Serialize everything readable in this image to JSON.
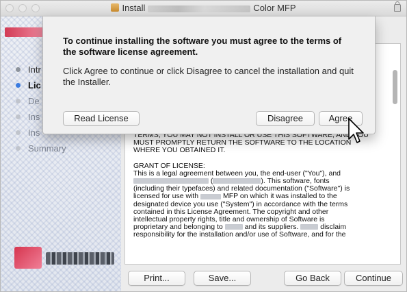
{
  "window": {
    "title_prefix": "Install",
    "title_suffix": "Color MFP"
  },
  "sidebar": {
    "steps": [
      {
        "label": "Intr",
        "state": "done"
      },
      {
        "label": "Lic",
        "state": "active"
      },
      {
        "label": "De",
        "state": "pending"
      },
      {
        "label": "Ins",
        "state": "pending"
      },
      {
        "label": "Ins",
        "state": "pending"
      },
      {
        "label": "Summary",
        "state": "pending"
      }
    ]
  },
  "license": {
    "paragraph1": "TERMS, YOU MAY NOT INSTALL OR USE THIS SOFTWARE, AND YOU MUST PROMPTLY RETURN THE SOFTWARE TO THE LOCATION WHERE YOU OBTAINED IT.",
    "heading2": "GRANT OF LICENSE:",
    "line2a": "This is a legal agreement between you, the end-user (\"You\"), and",
    "line2b": "). This software, fonts",
    "line2c": "(including their typefaces) and related documentation (\"Software\") is",
    "line2d_pre": "licensed for use with",
    "line2d_post": "MFP  on which it was installed to the",
    "line2e": "designated device you use (\"System\") in accordance with the terms",
    "line2f": "contained in this License Agreement.  The copyright and other",
    "line2g": "intellectual property rights, title and ownership of Software is",
    "line2h_pre": "proprietary and belonging to",
    "line2h_mid": "and its suppliers.",
    "line2h_post": "disclaim",
    "line2i": "responsibility for the installation and/or use of Software, and for the"
  },
  "buttons": {
    "print": "Print...",
    "save": "Save...",
    "go_back": "Go Back",
    "continue": "Continue"
  },
  "sheet": {
    "heading": "To continue installing the software you must agree to the terms of the software license agreement.",
    "body": "Click Agree to continue or click Disagree to cancel the installation and quit the Installer.",
    "read_license": "Read License",
    "disagree": "Disagree",
    "agree": "Agree"
  },
  "colors": {
    "active_step": "#3a7be0",
    "brand": "#d6354f"
  }
}
